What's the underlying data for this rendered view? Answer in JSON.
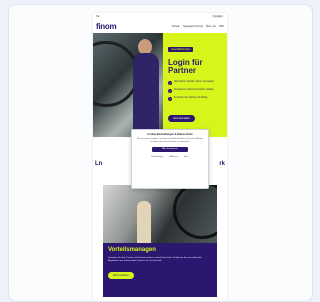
{
  "browser": {
    "topbar": {
      "locale": "DE",
      "contact_label": "Kontakt"
    },
    "logo": "finom",
    "nav": [
      "Vorteile",
      "Tagesgeld Umzug",
      "Über uns",
      "Hilfe"
    ]
  },
  "hero": {
    "badge": "Geschäftskunden",
    "title_line1": "Login für",
    "title_line2": "Partner",
    "bullets": [
      "Alle Partner-Vorteile nutzen und sparen",
      "Provisionen schnell und sicher erhalten",
      "Ihr Konto. Ihre Partner. Ihr Erfolg"
    ],
    "button_label": "Jetzt anmelden"
  },
  "section": {
    "heading_left": "Ln",
    "heading_right": "rk"
  },
  "feature": {
    "title": "Vorteilsmanagen",
    "text": "Verwalten Sie Ihre Partner und Vorteile einfach, schnell und sicher. Profitieren Sie von exklusiven Angeboten und umfassenden Services für Ihr Geschäft.",
    "button_label": "Mehr erfahren"
  },
  "cookie": {
    "title": "Cookie-Einstellungen & Datenschutz",
    "text": "Wir verwenden Cookies, um Ihnen das beste Erlebnis auf unserer Website zu bieten und unsere Dienste zu verbessern.",
    "accept_label": "Alle akzeptieren",
    "links": [
      "Einstellungen",
      "Ablehnen",
      "Mehr"
    ]
  },
  "colors": {
    "brand_purple": "#2b1670",
    "brand_lime": "#d8f51b"
  }
}
